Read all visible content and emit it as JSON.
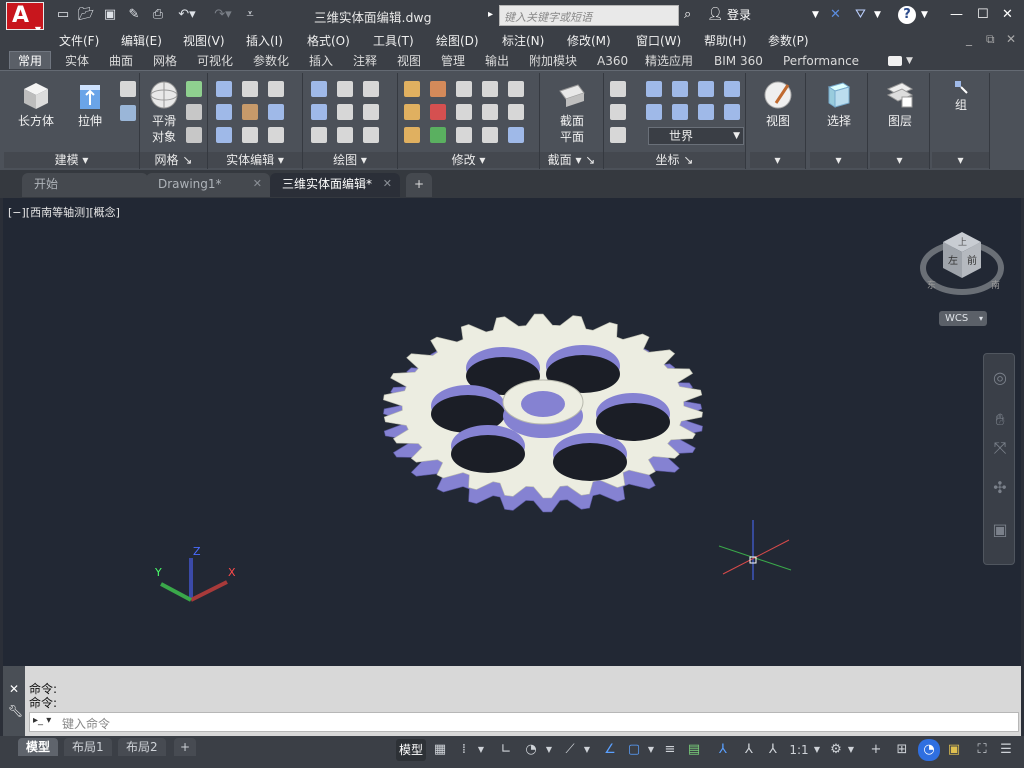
{
  "app": {
    "logo_letter": "A",
    "title": "三维实体面编辑.dwg"
  },
  "quick_access": {
    "icons": [
      "new-icon",
      "open-icon",
      "save-icon",
      "save-as-icon",
      "print-icon",
      "undo-icon",
      "redo-icon",
      "customize-icon"
    ]
  },
  "search": {
    "placeholder": "键入关键字或短语"
  },
  "title_right": {
    "login": "登录"
  },
  "menu": [
    "文件(F)",
    "编辑(E)",
    "视图(V)",
    "插入(I)",
    "格式(O)",
    "工具(T)",
    "绘图(D)",
    "标注(N)",
    "修改(M)",
    "窗口(W)",
    "帮助(H)",
    "参数(P)"
  ],
  "ribbon_tabs": [
    "常用",
    "实体",
    "曲面",
    "网格",
    "可视化",
    "参数化",
    "插入",
    "注释",
    "视图",
    "管理",
    "输出",
    "附加模块",
    "A360",
    "精选应用",
    "BIM 360",
    "Performance"
  ],
  "ribbon_active_tab": "常用",
  "panels": {
    "modeling": {
      "label": "建模",
      "box": "长方体",
      "extrude": "拉伸"
    },
    "mesh": {
      "label": "网格",
      "smooth": "平滑\n对象"
    },
    "solid_edit": {
      "label": "实体编辑"
    },
    "draw": {
      "label": "绘图"
    },
    "modify": {
      "label": "修改"
    },
    "section": {
      "label": "截面",
      "plane": "截面\n平面"
    },
    "coordinates": {
      "label": "坐标",
      "ucs_value": "世界"
    },
    "view": {
      "label": "视图"
    },
    "selection": {
      "label": "选择"
    },
    "layers": {
      "label": "图层"
    },
    "groups": {
      "label": "组"
    }
  },
  "file_tabs": [
    {
      "label": "开始",
      "active": false
    },
    {
      "label": "Drawing1*",
      "active": false
    },
    {
      "label": "三维实体面编辑*",
      "active": true
    }
  ],
  "viewport": {
    "label": "[−][西南等轴测][概念]",
    "viewcube": {
      "top": "上",
      "front": "前",
      "left": "左",
      "compass_e": "东",
      "compass_s": "南"
    },
    "wcs": "WCS",
    "ucs_axes": {
      "x": "X",
      "y": "Y",
      "z": "Z"
    }
  },
  "command": {
    "history": [
      "命令:",
      "命令:"
    ],
    "placeholder": "键入命令"
  },
  "layout_tabs": [
    "模型",
    "布局1",
    "布局2"
  ],
  "status": {
    "model": "模型",
    "scale": "1:1"
  },
  "colors": {
    "accent_red": "#c8161d",
    "gear_face": "#ecede1",
    "gear_side": "#8582d2",
    "viewport_bg": "#222834"
  }
}
